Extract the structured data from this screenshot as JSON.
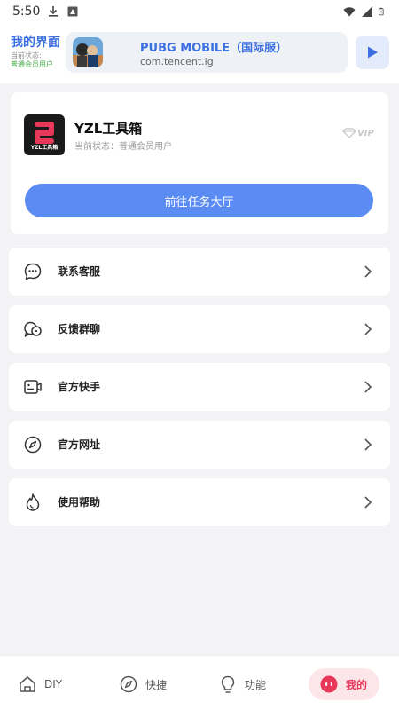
{
  "status_bar": {
    "time": "5:50",
    "icons": [
      "download-icon",
      "notification-icon",
      "wifi-icon",
      "signal-icon",
      "battery-icon"
    ]
  },
  "header": {
    "title": "我的界面",
    "sub_line1": "当前状态:",
    "sub_line2": "普通会员用户",
    "app_name": "PUBG MOBILE（国际服）",
    "app_package": "com.tencent.ig"
  },
  "profile": {
    "name": "YZL工具箱",
    "status": "当前状态：普通会员用户",
    "vip_label": "VIP",
    "logo_text": "YZL工具箱",
    "task_button": "前往任务大厅"
  },
  "menu": [
    {
      "label": "联系客服",
      "icon": "chat-bubble-icon"
    },
    {
      "label": "反馈群聊",
      "icon": "group-chat-icon"
    },
    {
      "label": "官方快手",
      "icon": "video-camera-icon"
    },
    {
      "label": "官方网址",
      "icon": "compass-icon"
    },
    {
      "label": "使用帮助",
      "icon": "help-drop-icon"
    }
  ],
  "nav": [
    {
      "label": "DIY",
      "icon": "home-icon"
    },
    {
      "label": "快捷",
      "icon": "compass-icon"
    },
    {
      "label": "功能",
      "icon": "bulb-icon"
    },
    {
      "label": "我的",
      "icon": "profile-face-icon"
    }
  ],
  "colors": {
    "accent": "#5b8cf4",
    "header_blue": "#3b6fe0",
    "active_red": "#e8385a",
    "background": "#f3f3f5"
  }
}
